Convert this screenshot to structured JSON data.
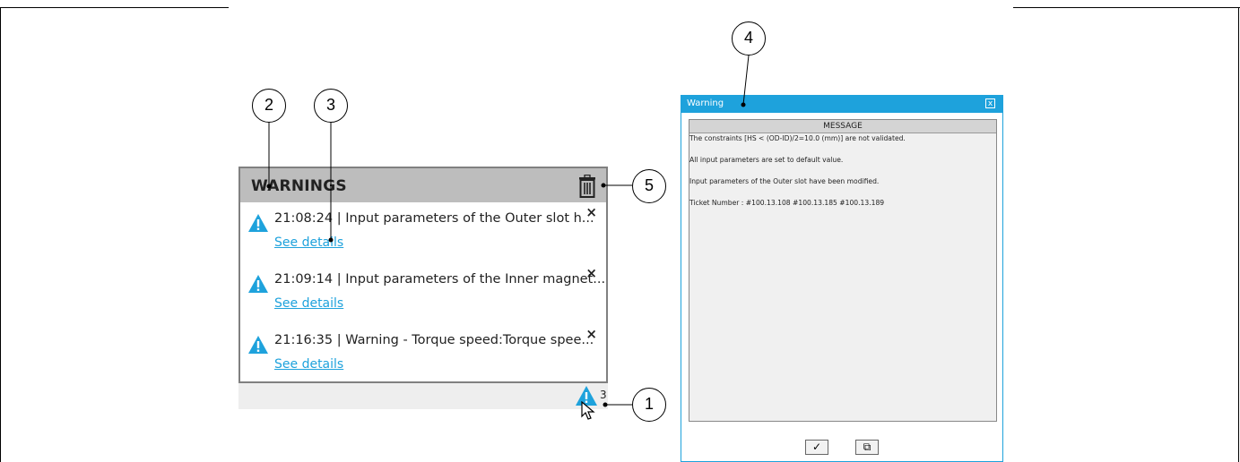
{
  "panel": {
    "title": "WARNINGS",
    "items": [
      {
        "text": "21:08:24 | Input parameters of the Outer slot h...",
        "link": "See details",
        "close": "×"
      },
      {
        "text": "21:09:14 | Input parameters of the Inner magnet...",
        "link": "See details",
        "close": "×"
      },
      {
        "text": "21:16:35 | Warning - Torque speed:Torque spee...",
        "link": "See details",
        "close": "×"
      }
    ],
    "count": "3"
  },
  "callouts": {
    "c1": "1",
    "c2": "2",
    "c3": "3",
    "c4": "4",
    "c5": "5"
  },
  "dialog": {
    "title": "Warning",
    "close": "x",
    "column_header": "MESSAGE",
    "lines": [
      "The constraints [HS < (OD-ID)/2=10.0 (mm)] are not validated.",
      "All input parameters are set to default value.",
      "Input parameters of the Outer slot have been modified.",
      "Ticket Number : #100.13.108 #100.13.185 #100.13.189"
    ],
    "ok_glyph": "✓",
    "layers_glyph": "⧉"
  },
  "colors": {
    "accent": "#1ea2dc",
    "header_gray": "#bdbdbd",
    "warn_blue": "#1ea2dc"
  },
  "icons": [
    "warning-triangle-icon",
    "trash-icon",
    "close-icon",
    "cursor-icon",
    "check-icon",
    "layers-icon"
  ]
}
